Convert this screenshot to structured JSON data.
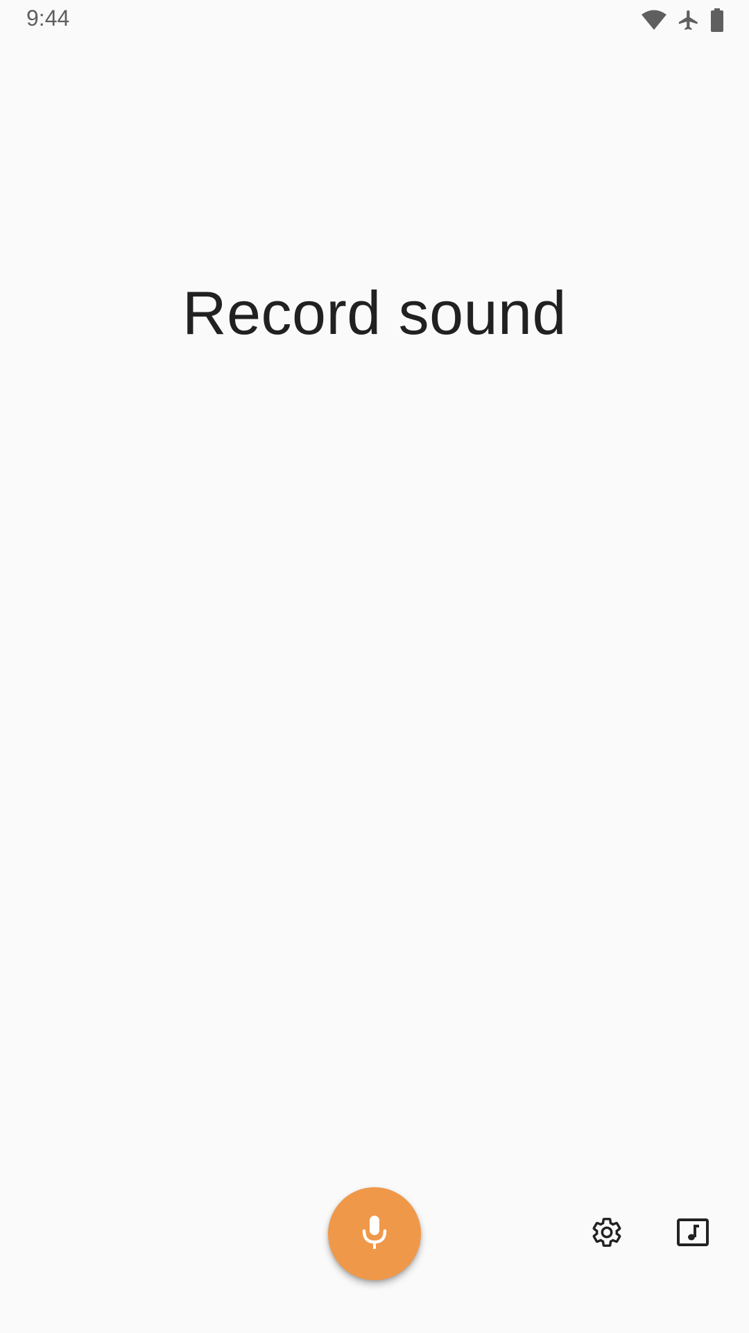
{
  "status_bar": {
    "time": "9:44",
    "icons": [
      "wifi-icon",
      "airplane-mode-icon",
      "battery-icon"
    ]
  },
  "main": {
    "title": "Record sound"
  },
  "controls": {
    "record_icon": "microphone-icon",
    "settings_icon": "gear-icon",
    "library_icon": "music-library-icon"
  },
  "colors": {
    "background": "#fafafa",
    "accent": "#f0984a",
    "title_text": "#212121",
    "status_text": "#5f5f5f"
  }
}
